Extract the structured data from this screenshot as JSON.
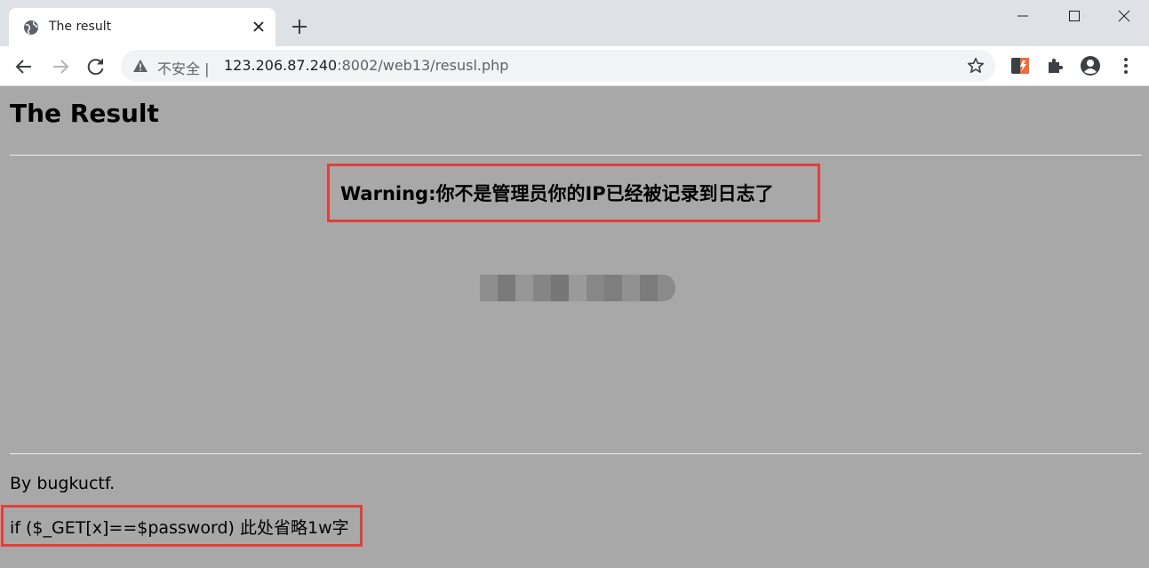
{
  "browser": {
    "tab": {
      "title": "The result",
      "favicon": "globe-icon"
    },
    "toolbar": {
      "security_label": "不安全",
      "url_host": "123.206.87.240",
      "url_path": ":8002/web13/resusl.php"
    },
    "icons": {
      "back": "back-arrow-icon",
      "forward": "forward-arrow-icon",
      "reload": "reload-icon",
      "bookmark": "star-icon",
      "extension_1": "extension-app-icon",
      "extensions": "puzzle-icon",
      "profile": "profile-icon",
      "menu": "kebab-menu-icon"
    }
  },
  "page": {
    "title": "The Result",
    "warning": "Warning:你不是管理员你的IP已经被记录到日志了",
    "byline": "By bugkuctf.",
    "code_hint": "if ($_GET[x]==$password) 此处省略1w字"
  },
  "colors": {
    "page_background": "#a8a8a8",
    "highlight_border": "#e0403c",
    "tabstrip": "#dee1e6"
  }
}
